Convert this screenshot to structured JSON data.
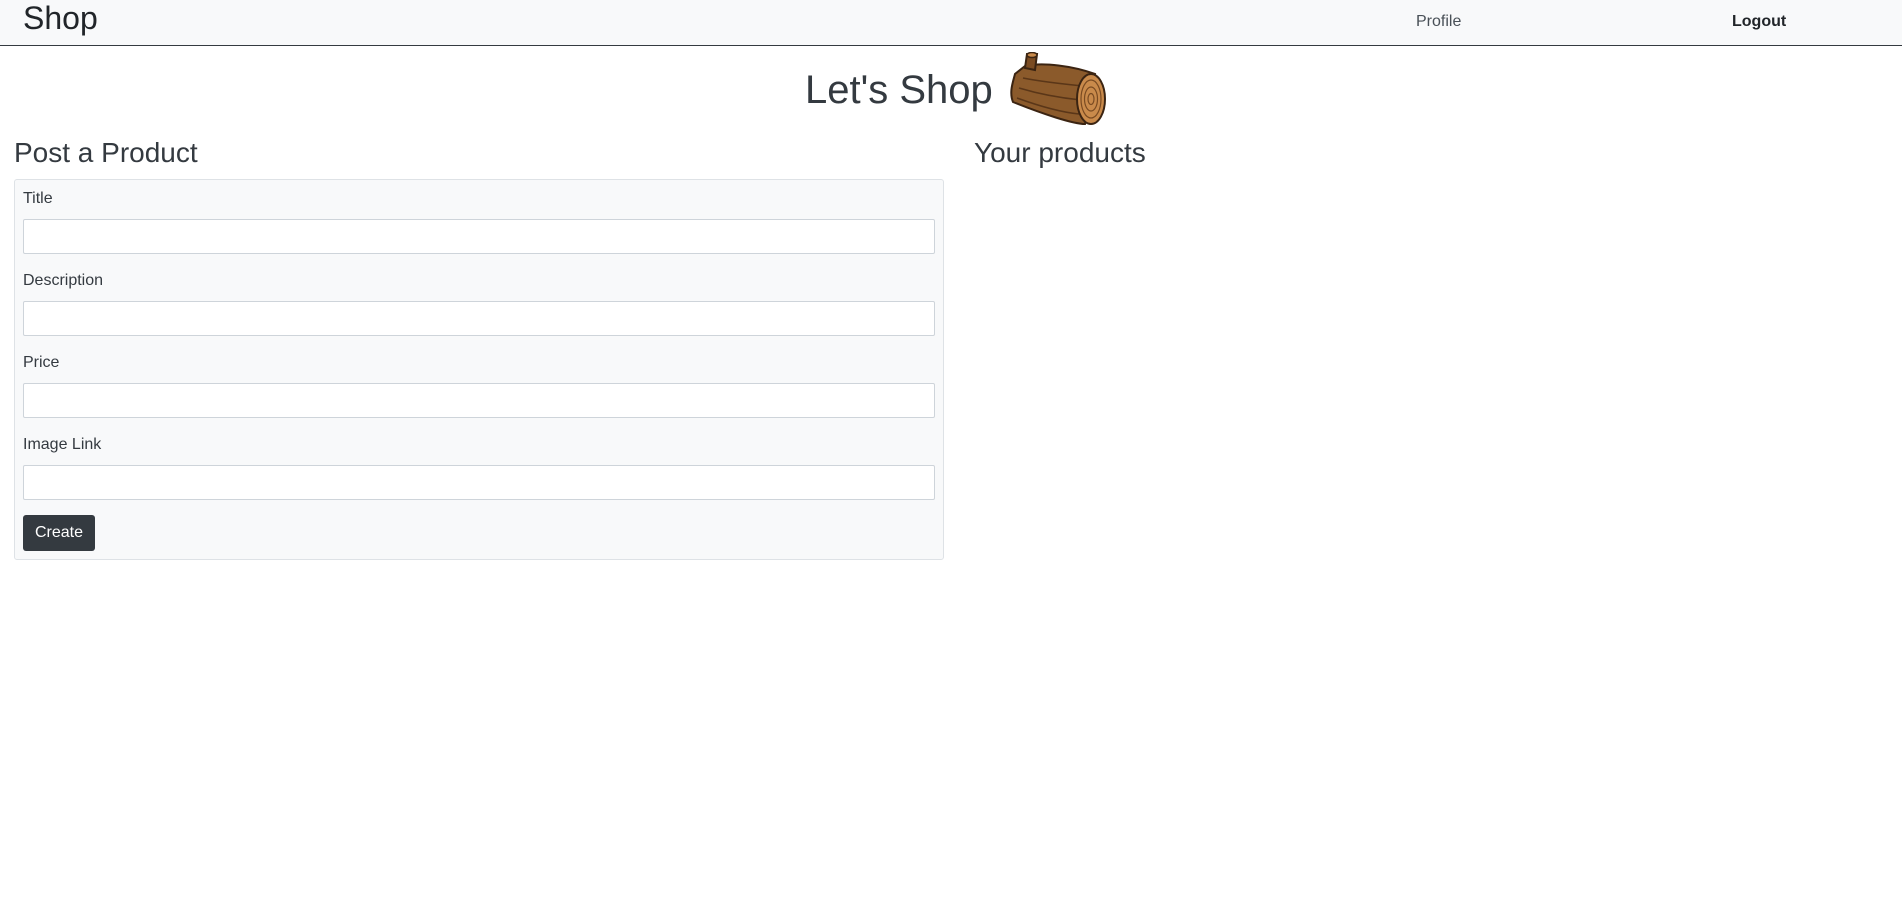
{
  "navbar": {
    "brand": "Shop",
    "profile_label": "Profile",
    "logout_label": "Logout"
  },
  "hero": {
    "title": "Let's Shop",
    "logo_icon": "wood-log-icon"
  },
  "post_form": {
    "heading": "Post a Product",
    "fields": [
      {
        "label": "Title",
        "value": "",
        "placeholder": ""
      },
      {
        "label": "Description",
        "value": "",
        "placeholder": ""
      },
      {
        "label": "Price",
        "value": "",
        "placeholder": ""
      },
      {
        "label": "Image Link",
        "value": "",
        "placeholder": ""
      }
    ],
    "submit_label": "Create"
  },
  "products": {
    "heading": "Your products",
    "items": []
  },
  "colors": {
    "navbar_bg": "#f8f9fa",
    "navbar_border": "#343a40",
    "button_bg": "#343a40",
    "button_text": "#ffffff",
    "card_bg": "#f8f9fa",
    "log_brown": "#8b5a2b"
  }
}
